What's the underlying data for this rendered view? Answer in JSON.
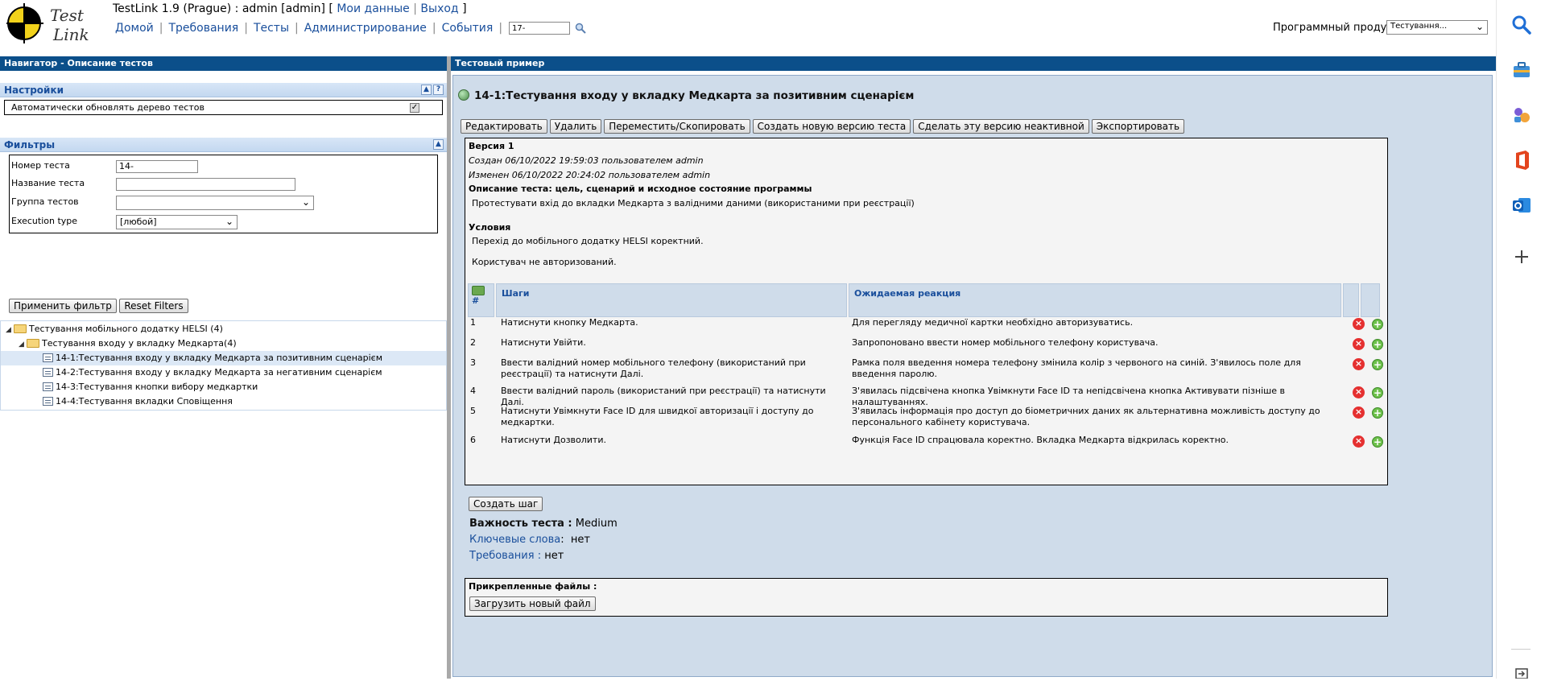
{
  "header": {
    "logo_text": "Test Link",
    "app_title": "TestLink 1.9 (Prague) : admin [admin]",
    "bracket_open": "[",
    "bracket_close": "]",
    "my_data": "Мои данные",
    "logout": "Выход",
    "menu": [
      "Домой",
      "Требования",
      "Тесты",
      "Администрирование",
      "События"
    ],
    "quick_search_value": "17-",
    "product_label": "Программный продукт",
    "product_value": "Тестування..."
  },
  "left": {
    "pane_title": "Навигатор - Описание тестов",
    "settings": {
      "title": "Настройки",
      "auto_refresh_label": "Автоматически обновлять дерево тестов"
    },
    "filters": {
      "title": "Фильтры",
      "test_number_label": "Номер теста",
      "test_number_value": "14-",
      "test_name_label": "Название теста",
      "test_suite_label": "Группа тестов",
      "execution_type_label": "Execution type",
      "execution_type_value": "[любой]",
      "apply_button": "Применить фильтр",
      "reset_button": "Reset Filters"
    },
    "tree": [
      "Тестування мобільного додатку HELSI (4)",
      "Тестування входу у вкладку Медкарта(4)",
      "14-1:Тестування входу у вкладку Медкарта за позитивним сценарієм",
      "14-2:Тестування входу у вкладку Медкарта за негативним сценарієм",
      "14-3:Тестування кнопки вибору медкартки",
      "14-4:Тестування вкладки Сповіщення"
    ]
  },
  "right": {
    "pane_title": "Тестовый пример",
    "tc_title": "14-1:Тестування входу у вкладку Медкарта за позитивним сценарієм",
    "actions": [
      "Редактировать",
      "Удалить",
      "Переместить/Скопировать",
      "Создать новую версию теста",
      "Сделать эту версию неактивной",
      "Экспортировать"
    ],
    "version": "Версия 1",
    "created": "Создан 06/10/2022 19:59:03  пользователем admin",
    "modified": "Изменен 06/10/2022 20:24:02  пользователем admin",
    "summary_label": "Описание теста: цель, сценарий и исходное состояние программы",
    "summary_text": "Протестувати вхід до вкладки Медкарта з валідними даними (використаними при реєстрації)",
    "preconditions_label": "Условия",
    "preconditions_1": "Перехід до мобільного додатку HELSI коректний.",
    "preconditions_2": "Користувач не авторизований.",
    "steps_header": {
      "num": "#",
      "steps": "Шаги",
      "expected": "Ожидаемая реакция"
    },
    "steps": [
      {
        "num": "1",
        "action": "Натиснути кнопку Медкарта.",
        "expected": "Для перегляду медичної картки необхідно авторизуватись."
      },
      {
        "num": "2",
        "action": "Натиснути Увійти.",
        "expected": "Запропоновано ввести номер мобільного телефону користувача."
      },
      {
        "num": "3",
        "action": "Ввести валідний номер мобільного телефону (використаний при реєстрації) та натиснути Далі.",
        "expected": "Рамка поля введення номера телефону змінила колір з червоного на синій. З'явилось поле для введення паролю."
      },
      {
        "num": "4",
        "action": "Ввести валідний пароль (використаний при реєстрації) та натиснути Далі.",
        "expected": "З'явилась підсвічена кнопка Увімкнути Face ID та непідсвічена кнопка Активувати пізніше в налаштуваннях."
      },
      {
        "num": "5",
        "action": "Натиснути Увімкнути Face ID для швидкої авторизації і доступу до медкартки.",
        "expected": "З'явилась інформація про доступ до біометричних даних як альтернативна можливість доступу до персонального   кабінету користувача."
      },
      {
        "num": "6",
        "action": "Натиснути Дозволити.",
        "expected": "Функція Face ID спрацювала коректно. Вкладка Медкарта відкрилась коректно."
      }
    ],
    "create_step_button": "Создать шаг",
    "importance_label": "Важность теста :",
    "importance_value": "Medium",
    "keywords_label": "Ключевые слова",
    "keywords_value": "нет",
    "requirements_label": "Требования :",
    "requirements_value": "нет",
    "attachments_label": "Прикрепленные файлы :",
    "upload_button": "Загрузить новый файл"
  }
}
